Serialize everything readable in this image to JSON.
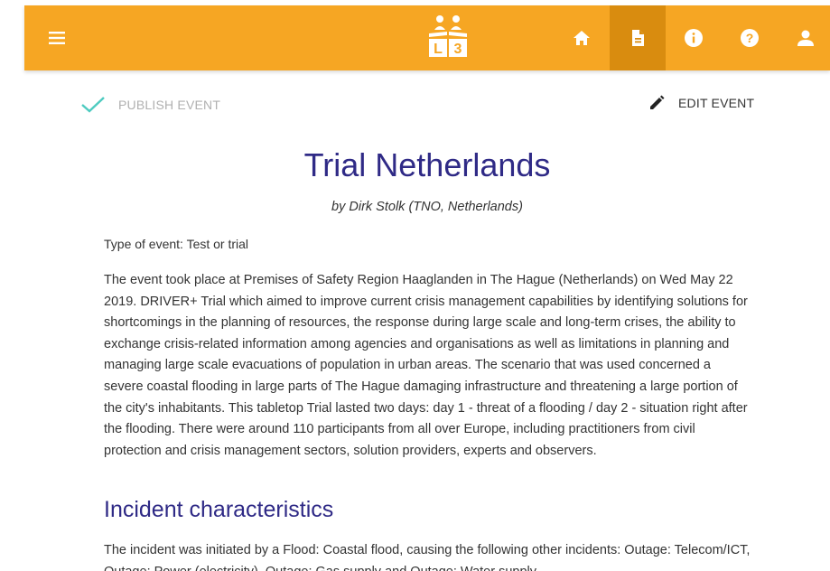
{
  "theme": {
    "accent": "#f6a623",
    "accent_dark": "#d98c0f",
    "heading_color": "#2f2a86",
    "check_color": "#4ecbc0"
  },
  "header": {
    "menu_icon": "hamburger-menu-icon",
    "logo_icon": "l3-logo-icon",
    "nav": [
      {
        "icon": "home-icon",
        "active": false
      },
      {
        "icon": "document-icon",
        "active": true
      },
      {
        "icon": "info-icon",
        "active": false
      },
      {
        "icon": "help-icon",
        "active": false
      },
      {
        "icon": "user-icon",
        "active": false
      }
    ]
  },
  "actions": {
    "publish_label": "PUBLISH EVENT",
    "edit_label": "EDIT EVENT"
  },
  "event": {
    "title": "Trial Netherlands",
    "byline": "by Dirk Stolk (TNO, Netherlands)",
    "type_line": "Type of event: Test or trial",
    "description": "The event took place at Premises of Safety Region Haaglanden in The Hague (Netherlands) on Wed May 22 2019. DRIVER+ Trial which aimed to improve current crisis management capabilities by identifying solutions for shortcomings in the planning of resources, the response during large scale and long-term crises, the ability to exchange crisis-related information among agencies and organisations as well as limitations in planning and managing large scale evacuations of population in urban areas. The scenario that was used concerned a severe coastal flooding in large parts of The Hague damaging infrastructure and threatening a large portion of the city's inhabitants. This tabletop Trial lasted two days: day 1 - threat of a flooding / day 2 - situation right after the flooding. There were around 110 participants from all over Europe, including practitioners from civil protection and crisis management sectors, solution providers, experts and observers."
  },
  "incident": {
    "section_title": "Incident characteristics",
    "description": "The incident was initiated by a Flood: Coastal flood, causing the following other incidents: Outage: Telecom/ICT, Outage: Power (electricity), Outage: Gas supply and Outage: Water supply."
  }
}
